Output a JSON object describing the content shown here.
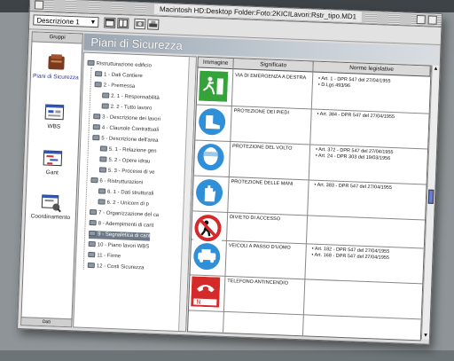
{
  "window": {
    "title": "Macintosh HD:Desktop Folder:Foto:2KICILavori:Rstr_tipo.MD1"
  },
  "toolbar": {
    "descr_select_value": "Descrizione 1"
  },
  "sidebar": {
    "header": "Gruppi",
    "footer": "Dati",
    "items": [
      {
        "label": "Piani di Sicurezza",
        "icon": "folder-book-icon"
      },
      {
        "label": "WBS",
        "icon": "window-grid-icon"
      },
      {
        "label": "Gant",
        "icon": "gantt-chart-icon"
      },
      {
        "label": "Coordinamento",
        "icon": "coordination-icon"
      }
    ]
  },
  "panel": {
    "title": "Piani di Sicurezza"
  },
  "tree": {
    "items": [
      "Ristrutturazione edificio",
      "1 - Dati Cantiere",
      "2 - Premessa",
      "2. 1 - Responsabilità",
      "2. 2 - Tutto lavoro",
      "3 - Descrizione dei lavori",
      "4 - Clausole Contrattuali",
      "5 - Descrizione dell'area",
      "5. 1 - Relazione gen",
      "5. 2 - Opere idrau",
      "5. 3 - Processi di ve",
      "6 - Ristrutturazioni",
      "6. 1 - Dati strutturali",
      "6. 2 - Unicorn di p",
      "7 - Organizzazione del ca",
      "8 - Adempimenti di cant",
      "9 - Segnaletica di cant",
      "10 - Piano lavori WBS",
      "11 - Firme",
      "12 - Costi Sicurezza"
    ]
  },
  "table": {
    "headers": [
      "Immagine",
      "Significato",
      "Norme legislative"
    ],
    "rows": [
      {
        "icon": "emergency-exit-sign-icon",
        "color": "#33a33a",
        "significato": "Via di emergenza a destra",
        "norme": [
          "Art. 1 - DPR 547 del 27/04/1955",
          "D.Lgs 493/96"
        ]
      },
      {
        "icon": "protective-footwear-sign-icon",
        "color": "#2f8fd8",
        "significato": "Protezione dei piedi",
        "norme": [
          "Art. 384 - DPR 547 del 27/04/1955"
        ]
      },
      {
        "icon": "face-protection-sign-icon",
        "color": "#2f8fd8",
        "significato": "Protezione del volto",
        "norme": [
          "Art. 372 - DPR 547 del 27/04/1955",
          "Art. 24 - DPR 303 del 19/03/1956"
        ]
      },
      {
        "icon": "hand-protection-sign-icon",
        "color": "#2f8fd8",
        "significato": "Protezione delle mani",
        "norme": [
          "Art. 383 - DPR 547 del 27/04/1955"
        ]
      },
      {
        "icon": "no-entry-sign-icon",
        "color": "#d42a2a",
        "significato": "Divieto di accesso",
        "norme": []
      },
      {
        "icon": "vehicle-passage-sign-icon",
        "color": "#2f8fd8",
        "significato": "Veicoli a passo d'uomo",
        "norme": [
          "Art. 182 - DPR 547 del 27/04/1955",
          "Art. 168 - DPR 547 del 27/04/1955"
        ]
      },
      {
        "icon": "fire-phone-sign-icon",
        "color": "#d42a2a",
        "significato": "Telefono antincendio",
        "norme": []
      }
    ]
  }
}
